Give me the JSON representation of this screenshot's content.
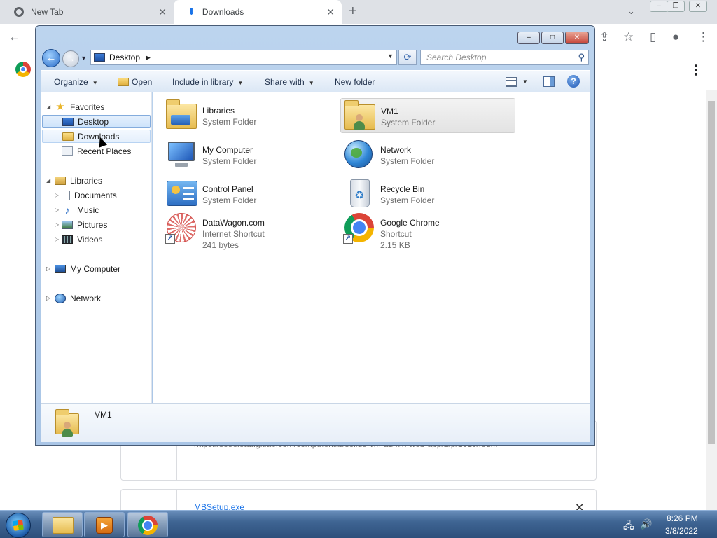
{
  "browser": {
    "tabs": [
      {
        "label": "New Tab",
        "icon": "chrome-icon"
      },
      {
        "label": "Downloads",
        "icon": "download-icon"
      }
    ],
    "download_items": [
      {
        "url": "https://sodeload.gitlab.com/computerlab/sollde-vm-admin-web-app/2/p/1010/rsd...",
        "filename": ""
      },
      {
        "url": "",
        "filename": "MBSetup.exe"
      }
    ]
  },
  "explorer": {
    "address": {
      "location": "Desktop"
    },
    "search": {
      "placeholder": "Search Desktop"
    },
    "commands": {
      "organize": "Organize",
      "open": "Open",
      "include_in_library": "Include in library",
      "share_with": "Share with",
      "new_folder": "New folder"
    },
    "nav": {
      "favorites": "Favorites",
      "desktop": "Desktop",
      "downloads": "Downloads",
      "recent_places": "Recent Places",
      "libraries": "Libraries",
      "documents": "Documents",
      "music": "Music",
      "pictures": "Pictures",
      "videos": "Videos",
      "my_computer": "My Computer",
      "network": "Network"
    },
    "items": [
      {
        "name": "Libraries",
        "type": "System Folder",
        "size": "",
        "icon": "libraries-icon"
      },
      {
        "name": "VM1",
        "type": "System Folder",
        "size": "",
        "icon": "user-folder-icon",
        "selected": true
      },
      {
        "name": "My Computer",
        "type": "System Folder",
        "size": "",
        "icon": "computer-icon"
      },
      {
        "name": "Network",
        "type": "System Folder",
        "size": "",
        "icon": "network-icon"
      },
      {
        "name": "Control Panel",
        "type": "System Folder",
        "size": "",
        "icon": "control-panel-icon"
      },
      {
        "name": "Recycle Bin",
        "type": "System Folder",
        "size": "",
        "icon": "recycle-bin-icon"
      },
      {
        "name": "DataWagon.com",
        "type": "Internet Shortcut",
        "size": "241 bytes",
        "icon": "datawagon-icon"
      },
      {
        "name": "Google Chrome",
        "type": "Shortcut",
        "size": "2.15 KB",
        "icon": "chrome-icon"
      }
    ],
    "details": {
      "name": "VM1"
    }
  },
  "taskbar": {
    "time": "8:26 PM",
    "date": "3/8/2022"
  }
}
